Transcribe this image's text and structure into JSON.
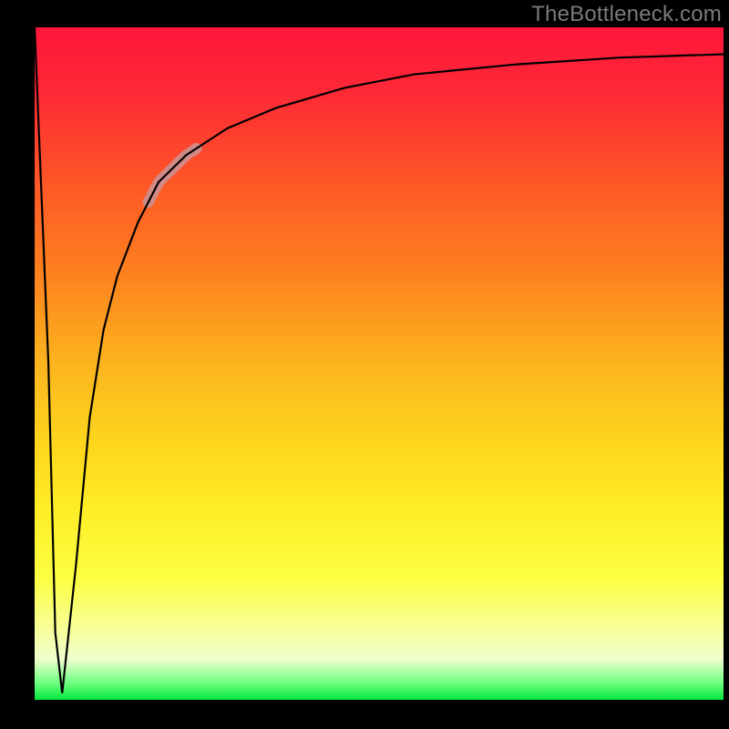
{
  "watermark": {
    "text": "TheBottleneck.com"
  },
  "colors": {
    "frame": "#000000",
    "watermark_text": "#7a7a7a",
    "curve": "#000000",
    "highlight": "#cf8d8a",
    "gradient_top": "#fe163a",
    "gradient_bottom": "#06e63b"
  },
  "chart_data": {
    "type": "line",
    "title": "",
    "xlabel": "",
    "ylabel": "",
    "xlim": [
      0,
      100
    ],
    "ylim": [
      0,
      100
    ],
    "series": [
      {
        "name": "bottleneck-curve",
        "x": [
          0,
          2,
          3,
          4,
          6,
          8,
          10,
          12,
          15,
          18,
          22,
          28,
          35,
          45,
          55,
          70,
          85,
          100
        ],
        "values": [
          100,
          50,
          10,
          1,
          20,
          42,
          55,
          63,
          71,
          77,
          81,
          85,
          88,
          91,
          93,
          94.5,
          95.5,
          96
        ]
      }
    ],
    "annotations": [
      {
        "name": "highlight-segment",
        "x_range": [
          16.5,
          23.5
        ],
        "note": "thick pink overlay along the curve"
      }
    ],
    "grid": false,
    "legend": false
  }
}
